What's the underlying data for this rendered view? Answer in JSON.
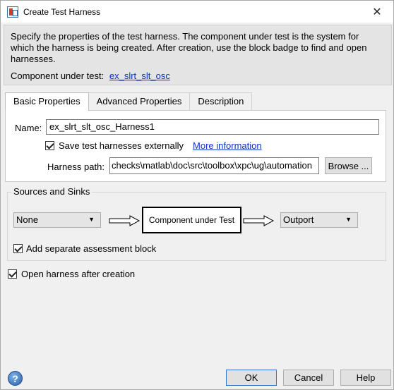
{
  "window": {
    "title": "Create Test Harness"
  },
  "description": {
    "text": "Specify the properties of the test harness. The component under test is the system for which the harness is being created. After creation, use the block badge to find and open harnesses.",
    "cut_label": "Component under test:",
    "cut_link": "ex_slrt_slt_osc"
  },
  "tabs": [
    {
      "label": "Basic Properties",
      "active": true
    },
    {
      "label": "Advanced Properties",
      "active": false
    },
    {
      "label": "Description",
      "active": false
    }
  ],
  "basic": {
    "name_label": "Name:",
    "name_value": "ex_slrt_slt_osc_Harness1",
    "save_label": "Save test harnesses externally",
    "save_checked": true,
    "more_info": "More information",
    "harness_path_label": "Harness path:",
    "harness_path_value": "checks\\matlab\\doc\\src\\toolbox\\xpc\\ug\\automation",
    "browse_label": "Browse ..."
  },
  "sources_sinks": {
    "title": "Sources and Sinks",
    "source_value": "None",
    "component_label": "Component under Test",
    "sink_value": "Outport",
    "assessment_label": "Add separate assessment block",
    "assessment_checked": true
  },
  "open_after": {
    "label": "Open harness after creation",
    "checked": true
  },
  "buttons": {
    "ok": "OK",
    "cancel": "Cancel",
    "help": "Help"
  },
  "icons": {
    "help": "question-mark-icon",
    "close": "close-icon",
    "app": "harness-app-icon"
  }
}
